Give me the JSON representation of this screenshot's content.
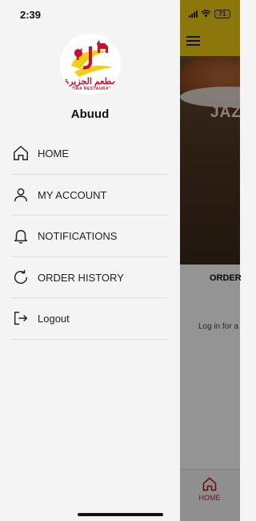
{
  "status": {
    "time": "2:39",
    "battery": "71"
  },
  "drawer": {
    "logo": {
      "arabic": "مطعم الجزيرة",
      "english": "JAZIRA RESTAURANT"
    },
    "user_name": "Abuud",
    "items": [
      {
        "label": "HOME",
        "icon": "home-icon"
      },
      {
        "label": "MY ACCOUNT",
        "icon": "user-icon"
      },
      {
        "label": "NOTIFICATIONS",
        "icon": "bell-icon"
      },
      {
        "label": "ORDER HISTORY",
        "icon": "refresh-icon"
      },
      {
        "label": "Logout",
        "icon": "logout-icon"
      }
    ]
  },
  "background": {
    "hero_title": "JAZ",
    "section_title": "ORDER",
    "login_hint": "Log in for a",
    "tab_home_label": "HOME"
  },
  "colors": {
    "brand_yellow": "#f2cf12",
    "brand_red": "#c8102e",
    "drawer_bg": "#f4f4f4"
  }
}
